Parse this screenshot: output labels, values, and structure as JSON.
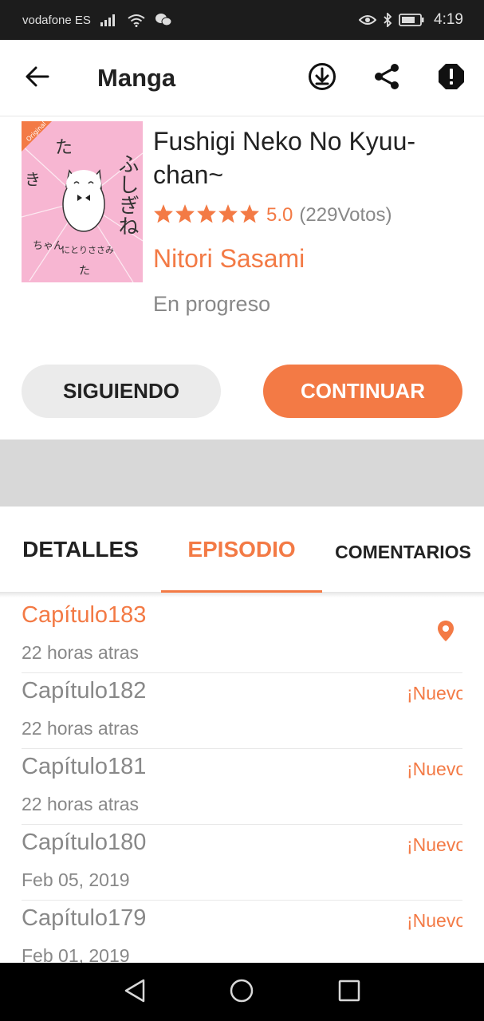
{
  "status_bar": {
    "carrier": "vodafone ES",
    "time": "4:19"
  },
  "app_bar": {
    "title": "Manga",
    "icons": [
      "back-arrow-icon",
      "download-icon",
      "share-icon",
      "report-icon"
    ]
  },
  "manga": {
    "title": "Fushigi Neko No Kyuu-chan~",
    "rating_value": "5.0",
    "rating_votes": "(229Votos)",
    "stars": 5,
    "author": "Nitori Sasami",
    "status": "En progreso",
    "cover": {
      "badge": "Original",
      "art_text": "ふしぎねこのきゅーちゃん",
      "artist_credit": "にとりささみ",
      "background_color": "#f7b6d2"
    }
  },
  "actions": {
    "follow_label": "SIGUIENDO",
    "continue_label": "CONTINUAR"
  },
  "tabs": [
    {
      "label": "DETALLES",
      "active": false
    },
    {
      "label": "EPISODIO",
      "active": true
    },
    {
      "label": "COMENTARIOS",
      "active": false
    }
  ],
  "chapters": [
    {
      "title": "Capítulo183",
      "date": "22 horas atras",
      "current": true,
      "badge": ""
    },
    {
      "title": "Capítulo182",
      "date": "22 horas atras",
      "current": false,
      "badge": "¡Nuevo!"
    },
    {
      "title": "Capítulo181",
      "date": "22 horas atras",
      "current": false,
      "badge": "¡Nuevo!"
    },
    {
      "title": "Capítulo180",
      "date": "Feb 05, 2019",
      "current": false,
      "badge": "¡Nuevo!"
    },
    {
      "title": "Capítulo179",
      "date": "Feb 01, 2019",
      "current": false,
      "badge": "¡Nuevo!"
    }
  ],
  "colors": {
    "accent": "#f37a45",
    "text_primary": "#222222",
    "text_secondary": "#888888",
    "follow_button_bg": "#ebebeb",
    "ad_band": "#d8d8d8"
  },
  "nav_bar": {
    "icons": [
      "nav-back-icon",
      "nav-home-icon",
      "nav-recents-icon"
    ]
  }
}
